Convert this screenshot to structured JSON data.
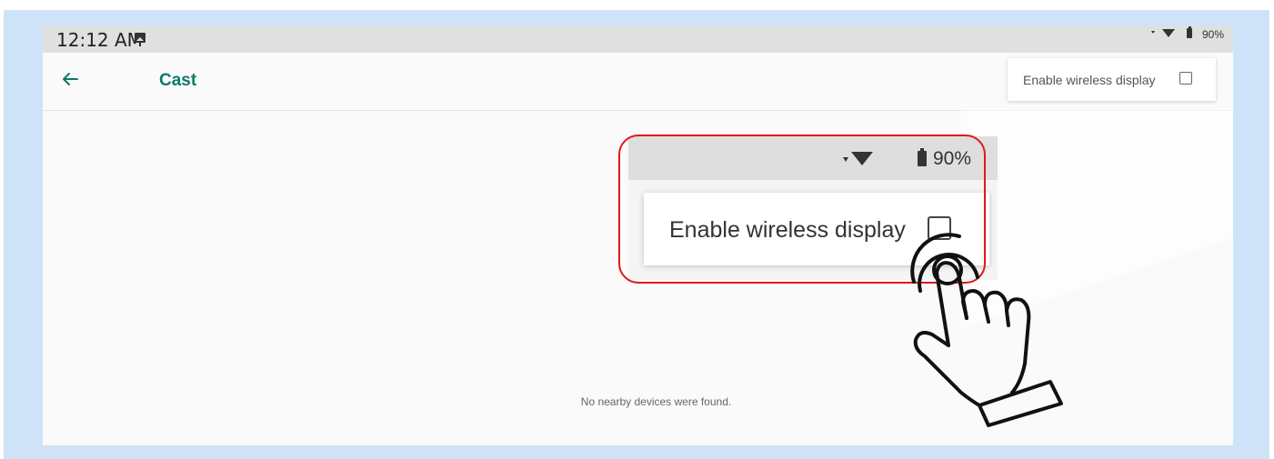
{
  "status_bar": {
    "time": "12:12 AM",
    "battery": "90%",
    "icons": [
      "image-notification-icon",
      "signal-icon",
      "wifi-icon",
      "battery-icon"
    ]
  },
  "toolbar": {
    "title": "Cast",
    "back_icon": "arrow-left-icon"
  },
  "overflow_menu": {
    "item_label": "Enable wireless display",
    "checked": false
  },
  "empty_state": {
    "message": "No nearby devices were found."
  },
  "zoom_callout": {
    "battery": "90%",
    "item_label": "Enable wireless display"
  },
  "colors": {
    "accent": "#0f7a66",
    "highlight": "#e0181c",
    "frame": "#cfe3f8"
  }
}
